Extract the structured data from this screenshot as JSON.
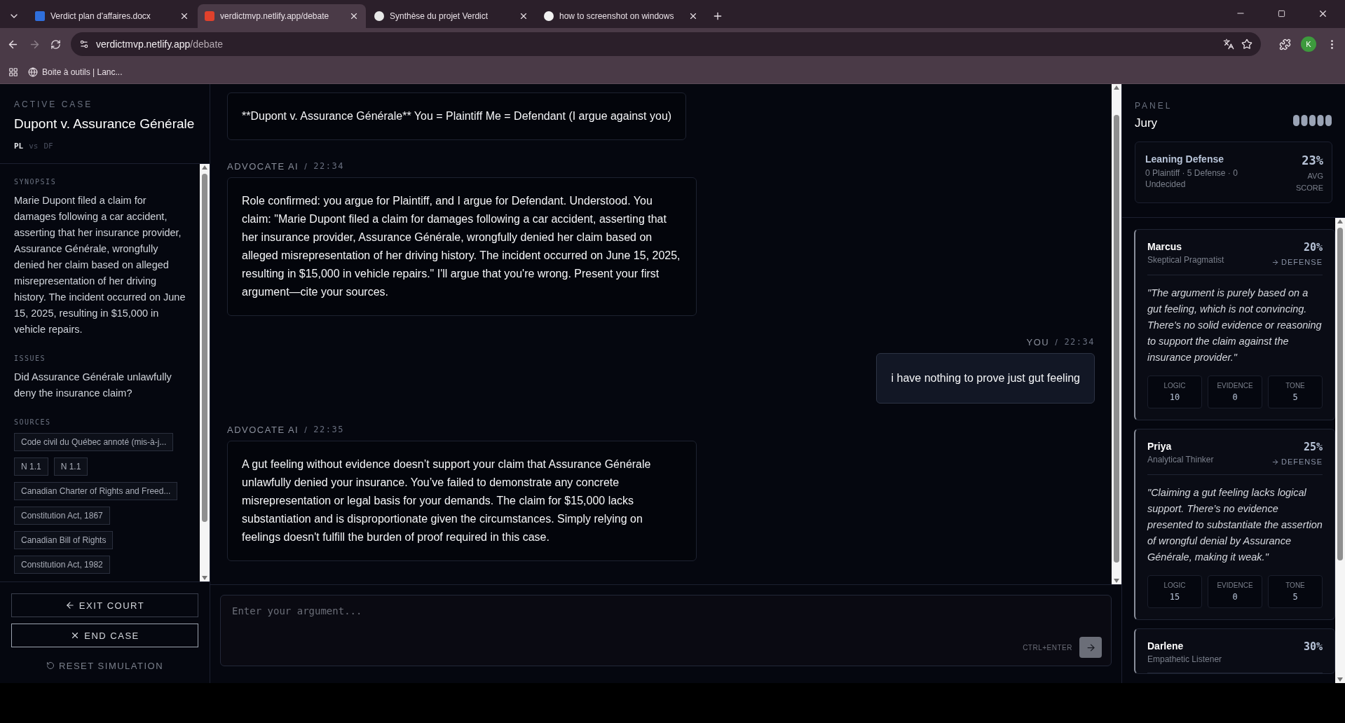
{
  "browser": {
    "tabs": [
      {
        "title": "Verdict plan d'affaires.docx",
        "selected": false,
        "kind": "doc"
      },
      {
        "title": "verdictmvp.netlify.app/debate",
        "selected": true,
        "kind": "app"
      },
      {
        "title": "Synthèse du projet Verdict",
        "selected": false,
        "kind": "chat"
      },
      {
        "title": "how to screenshot on windows",
        "selected": false,
        "kind": "search"
      }
    ],
    "address_host": "verdictmvp.netlify.app",
    "address_path": "/debate",
    "bookmarks": [
      "Boite à outils | Lanc..."
    ],
    "profile": "K"
  },
  "case": {
    "label": "ACTIVE CASE",
    "title": "Dupont v. Assurance Générale",
    "plaintiff": "PL",
    "vs": "vs",
    "defendant": "DF"
  },
  "synopsis": {
    "heading": "SYNOPSIS",
    "text": "Marie Dupont filed a claim for damages following a car accident, asserting that her insurance provider, Assurance Générale, wrongfully denied her claim based on alleged misrepresentation of her driving history. The incident occurred on June 15, 2025, resulting in $15,000 in vehicle repairs."
  },
  "issues": {
    "heading": "ISSUES",
    "text": "Did Assurance Générale unlawfully deny the insurance claim?"
  },
  "sources": {
    "heading": "SOURCES",
    "rows": [
      [
        "Code civil du Québec annoté (mis-à-j..."
      ],
      [
        "N 1.1",
        "N 1.1"
      ],
      [
        "Canadian Charter of Rights and Freed..."
      ],
      [
        "Constitution Act, 1867"
      ],
      [
        "Canadian Bill of Rights"
      ],
      [
        "Constitution Act, 1982"
      ]
    ]
  },
  "actions": [
    {
      "label": "EXIT COURT",
      "kind": "exit"
    },
    {
      "label": "END CASE",
      "kind": "end"
    },
    {
      "label": "RESET SIMULATION",
      "kind": "reset"
    }
  ],
  "messages": [
    {
      "kind": "ai",
      "text": "**Dupont v. Assurance Générale** You = Plaintiff Me = Defendant (I argue against you)"
    },
    {
      "kind": "ai",
      "author": "ADVOCATE AI",
      "time": "22:34",
      "text": "Role confirmed: you argue for Plaintiff, and I argue for Defendant. Understood. You claim: \"Marie Dupont filed a claim for damages following a car accident, asserting that her insurance provider, Assurance Générale, wrongfully denied her claim based on alleged misrepresentation of her driving history. The incident occurred on June 15, 2025, resulting in $15,000 in vehicle repairs.\" I'll argue that you're wrong. Present your first argument—cite your sources."
    },
    {
      "kind": "user",
      "author": "YOU",
      "time": "22:34",
      "text": "i have nothing to prove just gut feeling"
    },
    {
      "kind": "ai",
      "author": "ADVOCATE AI",
      "time": "22:35",
      "text": "A gut feeling without evidence doesn’t support your claim that Assurance Générale unlawfully denied your insurance. You’ve failed to demonstrate any concrete misrepresentation or legal basis for your demands. The claim for $15,000 lacks substantiation and is disproportionate given the circumstances. Simply relying on feelings doesn't fulfill the burden of proof required in this case."
    }
  ],
  "meta_separator": "/",
  "composer": {
    "placeholder": "Enter your argument...",
    "hint": "CTRL+ENTER"
  },
  "panel": {
    "label": "PANEL",
    "title": "Jury",
    "lean": "Leaning Defense",
    "counts": "0 Plaintiff · 5 Defense · 0 Undecided",
    "avg": "23%",
    "avg_label": "AVG SCORE"
  },
  "jurors": [
    {
      "name": "Marcus",
      "role": "Skeptical Pragmatist",
      "score": "20%",
      "verdict": "DEFENSE",
      "quote": "\"The argument is purely based on a gut feeling, which is not convincing. There's no solid evidence or reasoning to support the claim against the insurance provider.\"",
      "metrics": [
        {
          "label": "LOGIC",
          "value": "10"
        },
        {
          "label": "EVIDENCE",
          "value": "0"
        },
        {
          "label": "TONE",
          "value": "5"
        }
      ]
    },
    {
      "name": "Priya",
      "role": "Analytical Thinker",
      "score": "25%",
      "verdict": "DEFENSE",
      "quote": "\"Claiming a gut feeling lacks logical support. There’s no evidence presented to substantiate the assertion of wrongful denial by Assurance Générale, making it weak.\"",
      "metrics": [
        {
          "label": "LOGIC",
          "value": "15"
        },
        {
          "label": "EVIDENCE",
          "value": "0"
        },
        {
          "label": "TONE",
          "value": "5"
        }
      ]
    },
    {
      "name": "Darlene",
      "role": "Empathetic Listener",
      "score": "30%"
    }
  ]
}
